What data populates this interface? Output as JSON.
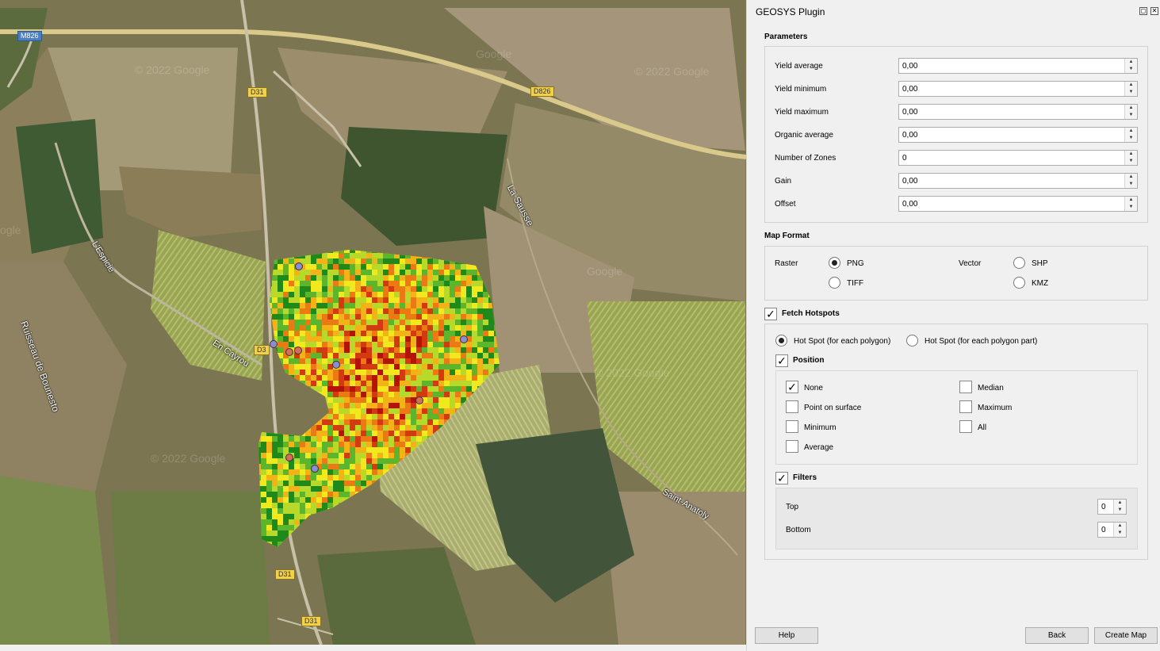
{
  "map": {
    "road_labels": [
      "M826",
      "D31",
      "D826",
      "D3",
      "D31",
      "D31"
    ],
    "place_names": [
      "La Sausse",
      "L'Espicie",
      "En Cayrou",
      "Ruisseau de Bounesto",
      "Saint-Anatoly"
    ],
    "watermarks": [
      "© 2022 Google",
      "© 2022 Google",
      "© 2022 Google",
      "Google",
      "Google",
      "ogle",
      "© 2022 Google"
    ],
    "hotspot_colors": {
      "blue": "#8e8bd0",
      "red": "#d86b5b"
    }
  },
  "panel": {
    "title": "GEOSYS Plugin",
    "parameters": {
      "heading": "Parameters",
      "rows": [
        {
          "label": "Yield average",
          "value": "0,00"
        },
        {
          "label": "Yield minimum",
          "value": "0,00"
        },
        {
          "label": "Yield maximum",
          "value": "0,00"
        },
        {
          "label": "Organic average",
          "value": "0,00"
        },
        {
          "label": "Number of Zones",
          "value": "0"
        },
        {
          "label": "Gain",
          "value": "0,00"
        },
        {
          "label": "Offset",
          "value": "0,00"
        }
      ]
    },
    "map_format": {
      "heading": "Map Format",
      "raster_label": "Raster",
      "vector_label": "Vector",
      "png": "PNG",
      "tiff": "TIFF",
      "shp": "SHP",
      "kmz": "KMZ"
    },
    "fetch_hotspots": {
      "label": "Fetch Hotspots",
      "opt_polygon": "Hot Spot (for each polygon)",
      "opt_part": "Hot Spot (for each polygon part)",
      "position_label": "Position",
      "positions": {
        "none": "None",
        "point_on_surface": "Point on surface",
        "minimum": "Minimum",
        "average": "Average",
        "median": "Median",
        "maximum": "Maximum",
        "all": "All"
      },
      "filters_label": "Filters",
      "top_label": "Top",
      "top_value": "0",
      "bottom_label": "Bottom",
      "bottom_value": "0"
    },
    "buttons": {
      "help": "Help",
      "back": "Back",
      "create_map": "Create Map"
    }
  }
}
